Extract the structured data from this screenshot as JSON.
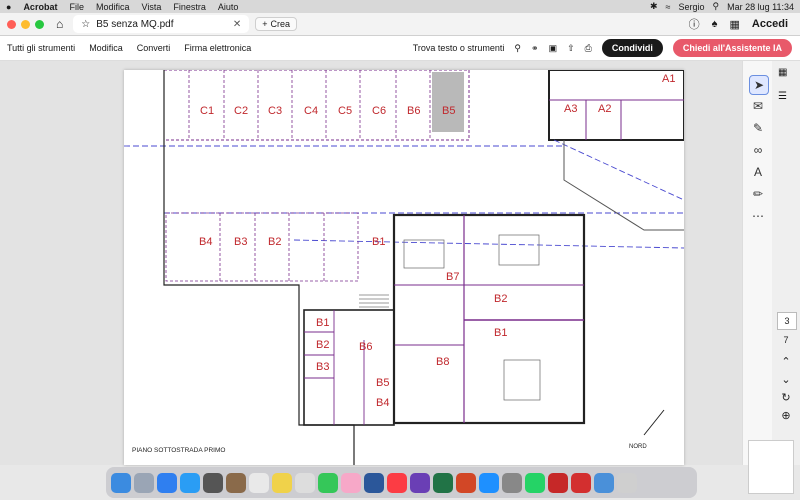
{
  "menubar": {
    "apple": "",
    "app_name": "Acrobat",
    "items": [
      "File",
      "Modifica",
      "Vista",
      "Finestra",
      "Aiuto"
    ],
    "user": "Sergio",
    "datetime": "Mar 28 lug  11:34"
  },
  "titlebar": {
    "tab_title": "B5 senza MQ.pdf",
    "new_tab_label": "Crea",
    "signin": "Accedi"
  },
  "toolbar": {
    "menu_items": [
      "Tutti gli strumenti",
      "Modifica",
      "Converti",
      "Firma elettronica"
    ],
    "search_label": "Trova testo o strumenti",
    "share_label": "Condividi",
    "ai_label": "Chiedi all'Assistente IA"
  },
  "pager": {
    "current": "3",
    "total": "7"
  },
  "drawing": {
    "top_boxes": [
      "C1",
      "C2",
      "C3",
      "C4",
      "C5",
      "C6",
      "B6",
      "B5"
    ],
    "top_right": [
      "A1",
      "A3",
      "A2"
    ],
    "mid_boxes": [
      "B4",
      "B3",
      "B2",
      "B1"
    ],
    "right_block": [
      "B7",
      "B2",
      "B1",
      "B8"
    ],
    "left_column": [
      "B1",
      "B2",
      "B3",
      "B6",
      "B5",
      "B4"
    ],
    "floor_label": "PIANO SOTTOSTRADA PRIMO",
    "north_label": "NORD"
  },
  "colors": {
    "label_red": "#c0282d",
    "wall_purple": "#7a2d8c",
    "dashed_blue": "#4a4ad0",
    "highlight_box": "#b9b9b9"
  }
}
